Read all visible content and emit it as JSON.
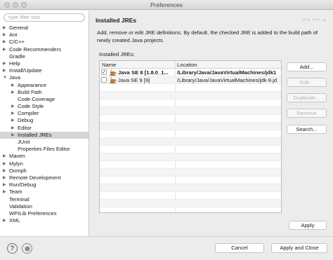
{
  "window": {
    "title": "Preferences"
  },
  "sidebar": {
    "filter_placeholder": "type filter text",
    "items": [
      {
        "label": "General",
        "level": 0,
        "expander": "right"
      },
      {
        "label": "Ant",
        "level": 0,
        "expander": "right"
      },
      {
        "label": "C/C++",
        "level": 0,
        "expander": "right"
      },
      {
        "label": "Code Recommenders",
        "level": 0,
        "expander": "right"
      },
      {
        "label": "Gradle",
        "level": 0,
        "expander": "none"
      },
      {
        "label": "Help",
        "level": 0,
        "expander": "right"
      },
      {
        "label": "Install/Update",
        "level": 0,
        "expander": "right"
      },
      {
        "label": "Java",
        "level": 0,
        "expander": "down"
      },
      {
        "label": "Appearance",
        "level": 1,
        "expander": "right"
      },
      {
        "label": "Build Path",
        "level": 1,
        "expander": "right"
      },
      {
        "label": "Code Coverage",
        "level": 1,
        "expander": "none"
      },
      {
        "label": "Code Style",
        "level": 1,
        "expander": "right"
      },
      {
        "label": "Compiler",
        "level": 1,
        "expander": "right"
      },
      {
        "label": "Debug",
        "level": 1,
        "expander": "right"
      },
      {
        "label": "Editor",
        "level": 1,
        "expander": "right"
      },
      {
        "label": "Installed JREs",
        "level": 1,
        "expander": "right",
        "selected": true
      },
      {
        "label": "JUnit",
        "level": 1,
        "expander": "none"
      },
      {
        "label": "Properties Files Editor",
        "level": 1,
        "expander": "none"
      },
      {
        "label": "Maven",
        "level": 0,
        "expander": "right"
      },
      {
        "label": "Mylyn",
        "level": 0,
        "expander": "right"
      },
      {
        "label": "Oomph",
        "level": 0,
        "expander": "right"
      },
      {
        "label": "Remote Development",
        "level": 0,
        "expander": "right"
      },
      {
        "label": "Run/Debug",
        "level": 0,
        "expander": "right"
      },
      {
        "label": "Team",
        "level": 0,
        "expander": "right"
      },
      {
        "label": "Terminal",
        "level": 0,
        "expander": "none"
      },
      {
        "label": "Validation",
        "level": 0,
        "expander": "none"
      },
      {
        "label": "WPILib Preferences",
        "level": 0,
        "expander": "none"
      },
      {
        "label": "XML",
        "level": 0,
        "expander": "right"
      }
    ]
  },
  "main": {
    "title": "Installed JREs",
    "description": "Add, remove or edit JRE definitions. By default, the checked JRE is added to the build path of newly created Java projects.",
    "list_label": "Installed JREs:",
    "columns": [
      "Name",
      "Location"
    ],
    "jres": [
      {
        "name": "Java SE 8 [1.8.0_1...",
        "location": "/Library/Java/JavaVirtualMachines/jdk1",
        "checked": true,
        "bold": true
      },
      {
        "name": "Java SE 9 [9]",
        "location": "/Library/Java/JavaVirtualMachines/jdk-9.jd",
        "checked": false,
        "bold": false
      }
    ],
    "buttons": {
      "add": "Add...",
      "edit": "Edit...",
      "duplicate": "Duplicate...",
      "remove": "Remove",
      "search": "Search...",
      "apply": "Apply"
    }
  },
  "footer": {
    "help_glyph": "?",
    "cancel": "Cancel",
    "apply_close": "Apply and Close"
  },
  "colors": {
    "selection": "#d6d6d6",
    "disabled_text": "#b2b2b2",
    "jre_icon": "#c77a1e"
  },
  "icons": [
    "help-icon",
    "import-export-icon",
    "back-arrow-icon",
    "forward-arrow-icon",
    "menu-chevron-icon",
    "jre-icon",
    "check-icon"
  ]
}
